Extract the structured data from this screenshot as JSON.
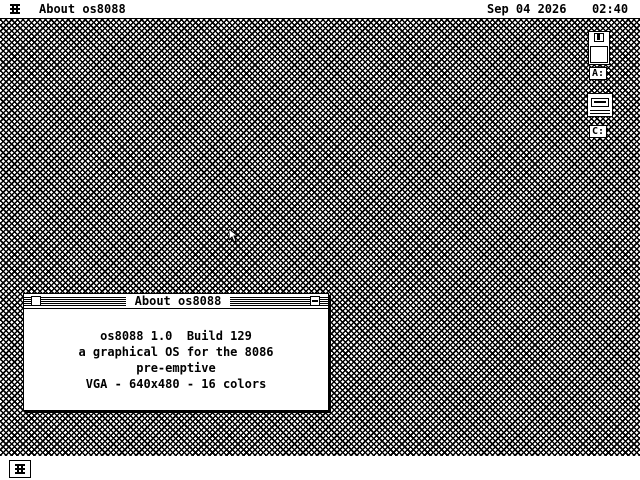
{
  "menubar": {
    "app_icon": "os-logo-icon",
    "title": "About os8088",
    "date": "Sep 04 2026",
    "time": "02:40"
  },
  "drives": [
    {
      "label": "A:",
      "icon": "floppy-drive-icon"
    },
    {
      "label": "C:",
      "icon": "hard-disk-icon"
    }
  ],
  "window": {
    "title": "About os8088",
    "lines": [
      "os8088 1.0  Build 129",
      "a graphical OS for the 8086",
      "pre-emptive",
      "VGA - 640x480 - 16 colors"
    ]
  },
  "taskbar": {
    "start_icon": "os-logo-icon"
  },
  "colors": {
    "foreground": "#000000",
    "background": "#ffffff"
  }
}
